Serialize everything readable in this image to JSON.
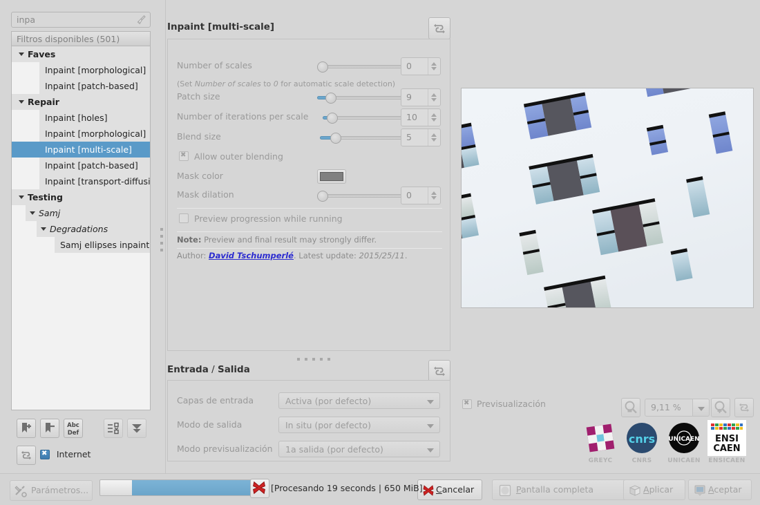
{
  "sidebar": {
    "search": {
      "value": "inpa",
      "placeholder": "inpa",
      "clear_icon": "broom-icon"
    },
    "list_header": "Filtros disponibles (501)",
    "tree": [
      {
        "label": "Faves",
        "depth": 0,
        "type": "category",
        "expanded": true
      },
      {
        "label": "Inpaint [morphological]",
        "depth": 1,
        "type": "item"
      },
      {
        "label": "Inpaint [patch-based]",
        "depth": 1,
        "type": "item"
      },
      {
        "label": "Repair",
        "depth": 0,
        "type": "category",
        "expanded": true
      },
      {
        "label": "Inpaint [holes]",
        "depth": 1,
        "type": "item"
      },
      {
        "label": "Inpaint [morphological]",
        "depth": 1,
        "type": "item"
      },
      {
        "label": "Inpaint [multi-scale]",
        "depth": 1,
        "type": "item",
        "selected": true
      },
      {
        "label": "Inpaint [patch-based]",
        "depth": 1,
        "type": "item"
      },
      {
        "label": "Inpaint [transport-diffusion]",
        "depth": 1,
        "type": "item"
      },
      {
        "label": "Testing",
        "depth": 0,
        "type": "category",
        "expanded": true
      },
      {
        "label": "Samj",
        "depth": 1,
        "type": "subcategory",
        "expanded": true
      },
      {
        "label": "Degradations",
        "depth": 2,
        "type": "subcategory",
        "expanded": true
      },
      {
        "label": "Samj ellipses inpaint",
        "depth": 3,
        "type": "item"
      }
    ],
    "toolbar": [
      {
        "name": "add-fave-button",
        "icon": "bookmark-plus-icon"
      },
      {
        "name": "remove-fave-button",
        "icon": "bookmark-minus-icon"
      },
      {
        "name": "rename-fave-button",
        "icon": "abc-def-icon"
      },
      {
        "name": "expand-collapse-button",
        "icon": "tree-list-icon"
      },
      {
        "name": "collapse-all-button",
        "icon": "double-chevron-down-icon"
      },
      {
        "name": "refresh-filters-button",
        "icon": "refresh-icon"
      }
    ],
    "internet": {
      "label": "Internet",
      "checked": true,
      "enabled": false
    }
  },
  "params": {
    "title": "Inpaint [multi-scale]",
    "reset_icon": "refresh-icon",
    "rows": [
      {
        "label": "Number of scales",
        "value": "0",
        "slider_pct": 0,
        "type": "slider"
      },
      {
        "label": "Patch size",
        "value": "9",
        "slider_pct": 9,
        "type": "slider"
      },
      {
        "label": "Number of iterations per scale",
        "value": "10",
        "slider_pct": 5,
        "type": "slider"
      },
      {
        "label": "Blend size",
        "value": "5",
        "slider_pct": 10,
        "type": "slider"
      },
      {
        "label": "Mask dilation",
        "value": "0",
        "slider_pct": 0,
        "type": "slider"
      }
    ],
    "hint": {
      "prefix": "(Set ",
      "em1": "Number of scales",
      "mid": " to ",
      "em2": "0",
      "suffix": " for automatic scale detection)"
    },
    "allow_outer_blending": {
      "label": "Allow outer blending",
      "checked": true
    },
    "mask_color": {
      "label": "Mask color",
      "swatch": "#808080"
    },
    "preview_progression": {
      "label": "Preview progression while running",
      "checked": false
    },
    "note": {
      "bold": "Note:",
      "text": " Preview and final result may strongly differ."
    },
    "author": {
      "prefix": "Author: ",
      "name": "David Tschumperlé",
      "mid": ". Latest update: ",
      "date": "2015/25/11",
      "suffix": "."
    }
  },
  "io": {
    "title_a": "Entrada",
    "title_sep": " / ",
    "title_b": "Salida",
    "reset_icon": "refresh-icon",
    "rows": [
      {
        "label": "Capas de entrada",
        "value": "Activa (por defecto)"
      },
      {
        "label": "Modo de salida",
        "value": "In situ (por defecto)"
      },
      {
        "label": "Modo previsualización",
        "value": "1a salida (por defecto)"
      }
    ]
  },
  "preview": {
    "checkbox_label": "Previsualización",
    "checked": true,
    "zoom_value": "9,11 %",
    "zoom_out_icon": "zoom-out-icon",
    "zoom_in_icon": "zoom-in-icon",
    "reset_view_icon": "refresh-icon",
    "dropdown_icon": "chevron-down-icon"
  },
  "logos": [
    {
      "caption": "GREYC",
      "name": "greyc-logo"
    },
    {
      "caption": "CNRS",
      "name": "cnrs-logo"
    },
    {
      "caption": "UNICAEN",
      "name": "unicaen-logo"
    },
    {
      "caption": "ENSICAEN",
      "name": "ensicaen-logo"
    }
  ],
  "bottom": {
    "parameters_button": {
      "label": "Parámetros...",
      "enabled": false,
      "icon": "tools-icon"
    },
    "status": "[Procesando 19 seconds | 650 MiB]",
    "stop_icon": "red-x-icon",
    "cancel_button": {
      "label": "Cancelar",
      "mnemonic": "C",
      "icon": "red-x-icon"
    },
    "fullscreen_button": {
      "label": "Pantalla completa",
      "mnemonic": "P",
      "enabled": false,
      "icon": "fullscreen-icon"
    },
    "apply_button": {
      "label": "Aplicar",
      "mnemonic": "A",
      "enabled": false,
      "icon": "apply-icon"
    },
    "ok_button": {
      "label": "Aceptar",
      "mnemonic": "A",
      "enabled": false,
      "icon": "ok-icon"
    },
    "progress_pct": 80
  },
  "colors": {
    "accent": "#5a9ac8",
    "progress": "#6ba5ca",
    "panel_bg": "#d6d6d6",
    "link": "#2b2bd0"
  }
}
